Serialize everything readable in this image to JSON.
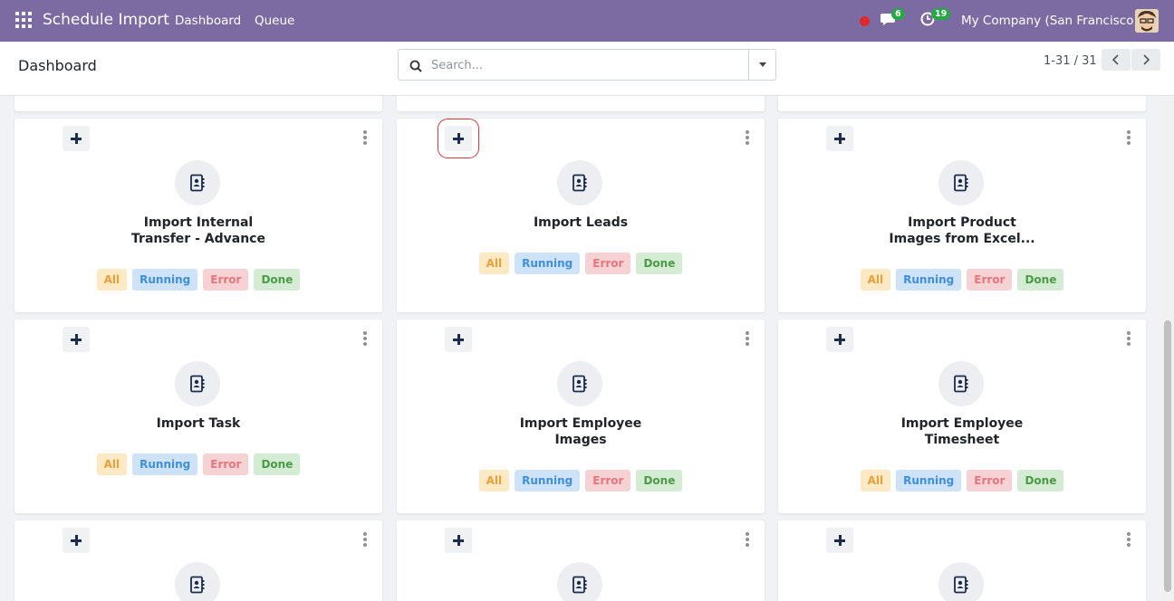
{
  "navbar": {
    "app_title": "Schedule Import",
    "links": [
      "Dashboard",
      "Queue"
    ],
    "chat_count": "6",
    "activity_count": "19",
    "company": "My Company (San Francisco)"
  },
  "control_panel": {
    "breadcrumb": "Dashboard",
    "search_placeholder": "Search...",
    "pager": "1-31 / 31"
  },
  "tags": {
    "all": "All",
    "running": "Running",
    "error": "Error",
    "done": "Done"
  },
  "cards": [
    {
      "title_lines": [
        "Import Internal",
        "Transfer - Advance"
      ]
    },
    {
      "title_lines": [
        "Import Leads"
      ]
    },
    {
      "title_lines": [
        "Import Product",
        "Images from Excel..."
      ]
    },
    {
      "title_lines": [
        "Import Task"
      ]
    },
    {
      "title_lines": [
        "Import Employee",
        "Images"
      ]
    },
    {
      "title_lines": [
        "Import Employee",
        "Timesheet"
      ]
    }
  ],
  "colors": {
    "navbar": "#7c6ba3",
    "tag_all": "#fde9c4",
    "tag_running": "#cfe3f8",
    "tag_error": "#f6d2d5",
    "tag_done": "#d4ecd3",
    "highlight": "#d9383a"
  }
}
